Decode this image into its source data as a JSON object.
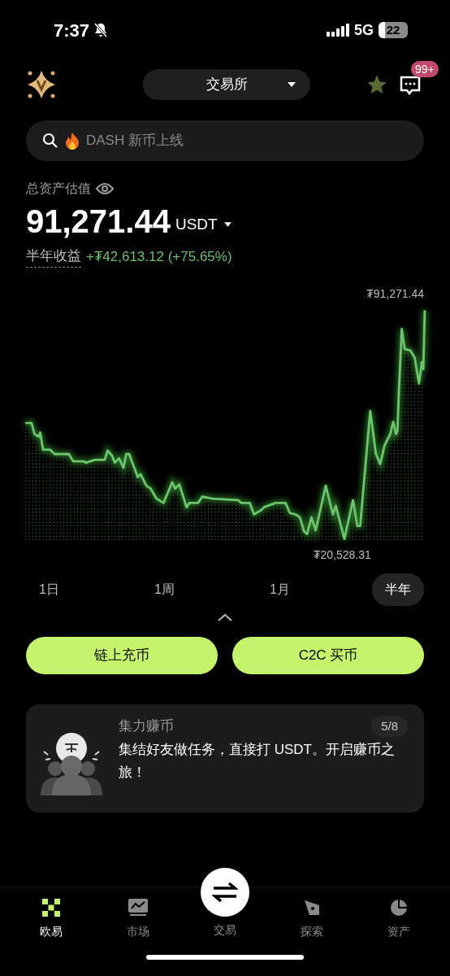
{
  "status_bar": {
    "time": "7:37",
    "network": "5G",
    "battery": "22"
  },
  "header": {
    "exchange_selector": "交易所",
    "message_badge": "99+"
  },
  "search": {
    "placeholder": "DASH 新币上线"
  },
  "assets": {
    "label": "总资产估值",
    "value": "91,271.44",
    "currency": "USDT",
    "pnl_label": "半年收益",
    "pnl_value": "+₮42,613.12 (+75.65%)"
  },
  "chart": {
    "max_label": "₮91,271.44",
    "min_label": "₮20,528.31"
  },
  "periods": [
    {
      "label": "1日",
      "selected": false
    },
    {
      "label": "1周",
      "selected": false
    },
    {
      "label": "1月",
      "selected": false
    },
    {
      "label": "半年",
      "selected": true
    }
  ],
  "actions": [
    "链上充币",
    "C2C 买币"
  ],
  "promo": {
    "title": "集力赚币",
    "text": "集结好友做任务，直接打 USDT。开启赚币之旅！",
    "progress": "5/8"
  },
  "bottom_nav": [
    {
      "label": "欧易",
      "kind": "home",
      "selected": true
    },
    {
      "label": "市场",
      "kind": "market",
      "selected": false
    },
    {
      "label": "交易",
      "kind": "trade",
      "selected": false
    },
    {
      "label": "探索",
      "kind": "explore",
      "selected": false
    },
    {
      "label": "资产",
      "kind": "assets",
      "selected": false
    }
  ]
}
